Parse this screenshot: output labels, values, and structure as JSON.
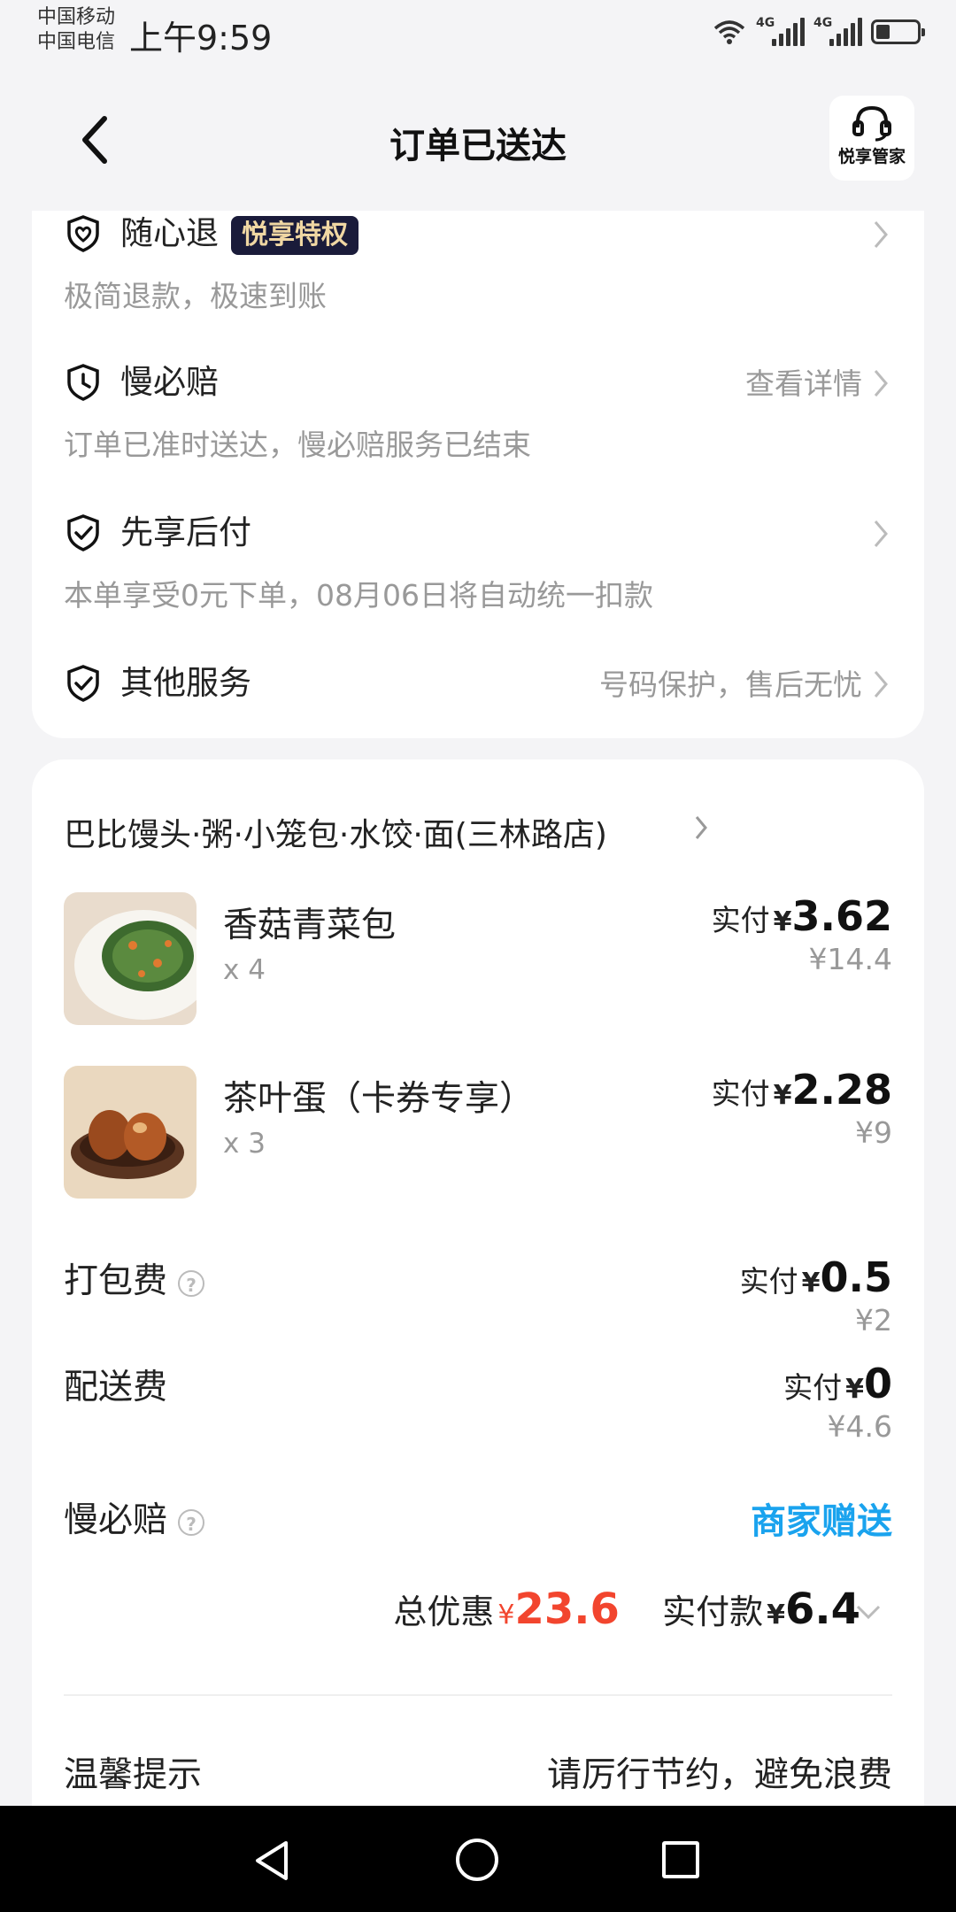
{
  "status_bar": {
    "carrier_1": "中国移动",
    "carrier_2": "中国电信",
    "time": "上午9:59",
    "network_1": "4G",
    "network_2": "4G",
    "battery_level": 0.35
  },
  "header": {
    "title": "订单已送达",
    "butler_label": "悦享管家"
  },
  "services": [
    {
      "name": "随心退",
      "badge": "悦享特权",
      "sub": "极简退款，极速到账",
      "right": ""
    },
    {
      "name": "慢必赔",
      "badge": "",
      "sub": "订单已准时送达，慢必赔服务已结束",
      "right": "查看详情"
    },
    {
      "name": "先享后付",
      "badge": "",
      "sub": "本单享受0元下单，08月06日将自动统一扣款",
      "right": ""
    },
    {
      "name": "其他服务",
      "badge": "",
      "sub": "",
      "right": "号码保护，售后无忧"
    }
  ],
  "order": {
    "shop_name": "巴比馒头·粥·小笼包·水饺·面(三林路店)",
    "paid_label": "实付",
    "currency": "¥",
    "items": [
      {
        "name": "香菇青菜包",
        "qty": "x 4",
        "paid": "3.62",
        "original": "¥14.4",
        "thumb_icon": "bun-thumbnail"
      },
      {
        "name": "茶叶蛋（卡券专享）",
        "qty": "x 3",
        "paid": "2.28",
        "original": "¥9",
        "thumb_icon": "tea-egg-thumbnail"
      }
    ],
    "fees": [
      {
        "name": "打包费",
        "paid": "0.5",
        "original": "¥2"
      },
      {
        "name": "配送费",
        "paid": "0",
        "original": "¥4.6"
      }
    ],
    "insurance": {
      "name": "慢必赔",
      "value": "商家赠送"
    },
    "summary": {
      "discount_label": "总优惠",
      "discount_amount": "23.6",
      "actual_label": "实付款",
      "actual_amount": "6.4"
    },
    "tip": {
      "label": "温馨提示",
      "text": "请厉行节约，避免浪费"
    }
  }
}
